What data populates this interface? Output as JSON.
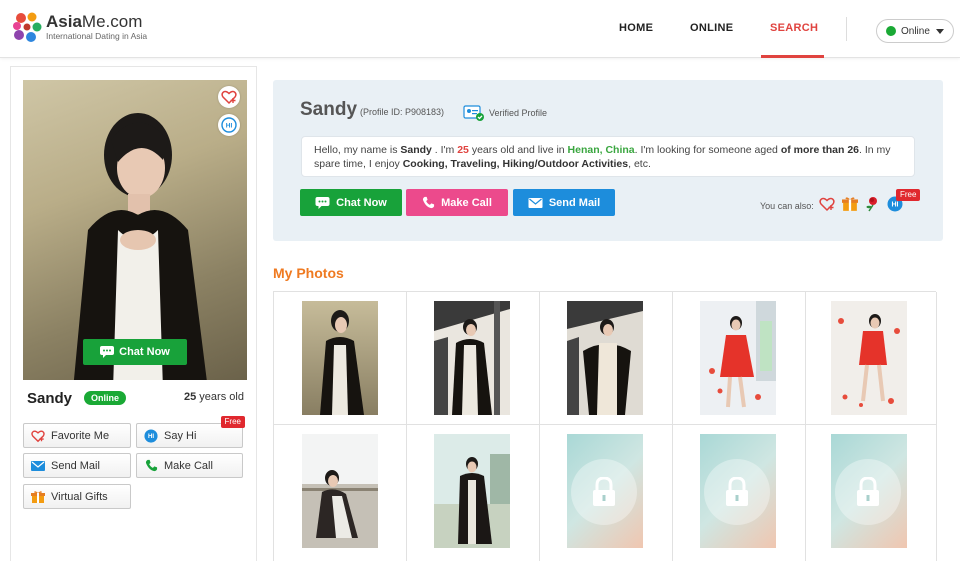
{
  "header": {
    "logo_name_bold": "Asia",
    "logo_name_rest": "Me.com",
    "logo_tagline": "International Dating in Asia",
    "nav": [
      {
        "label": "HOME"
      },
      {
        "label": "ONLINE"
      },
      {
        "label": "SEARCH",
        "active": true
      }
    ],
    "status_label": "Online",
    "accent_color": "#e0433f"
  },
  "profile": {
    "name": "Sandy",
    "online_badge": "Online",
    "age_number": "25",
    "age_suffix": " years old",
    "photo_chat_label": "Chat Now",
    "side_actions": [
      {
        "label": "Favorite Me",
        "icon": "heart-plus-icon"
      },
      {
        "label": "Say Hi",
        "icon": "hi-bubble-icon",
        "badge": "Free"
      },
      {
        "label": "Send Mail",
        "icon": "mail-icon"
      },
      {
        "label": "Make Call",
        "icon": "phone-icon"
      },
      {
        "label": "Virtual Gifts",
        "icon": "gift-icon"
      }
    ]
  },
  "info": {
    "name": "Sandy",
    "profile_id": "(Profile ID: P908183)",
    "verified_label": "Verified Profile",
    "bio": {
      "p1": "Hello, my name is ",
      "name": "Sandy",
      "p2": " . I'm ",
      "age": "25",
      "p3": " years old and live in ",
      "location": "Henan, China",
      "p4": ". I'm looking for someone aged ",
      "age_pref": "of more than 26",
      "p5": ". In my spare time, I enjoy ",
      "hobbies": "Cooking, Traveling, Hiking/Outdoor Activities",
      "p6": ", etc."
    },
    "buttons": [
      {
        "label": "Chat Now",
        "color": "#18a23a"
      },
      {
        "label": "Make Call",
        "color": "#ec4a8c"
      },
      {
        "label": "Send Mail",
        "color": "#1d8ddc"
      }
    ],
    "you_can_also": "You can also:",
    "free_badge": "Free",
    "extra_icons": [
      "heart-plus-icon",
      "gift-icon",
      "rose-icon",
      "hi-bubble-icon"
    ]
  },
  "photos": {
    "title": "My Photos",
    "title_color": "#ef7a21",
    "items": [
      {
        "locked": false
      },
      {
        "locked": false
      },
      {
        "locked": false
      },
      {
        "locked": false
      },
      {
        "locked": false
      },
      {
        "locked": false
      },
      {
        "locked": false
      },
      {
        "locked": true
      },
      {
        "locked": true
      },
      {
        "locked": true
      }
    ]
  }
}
